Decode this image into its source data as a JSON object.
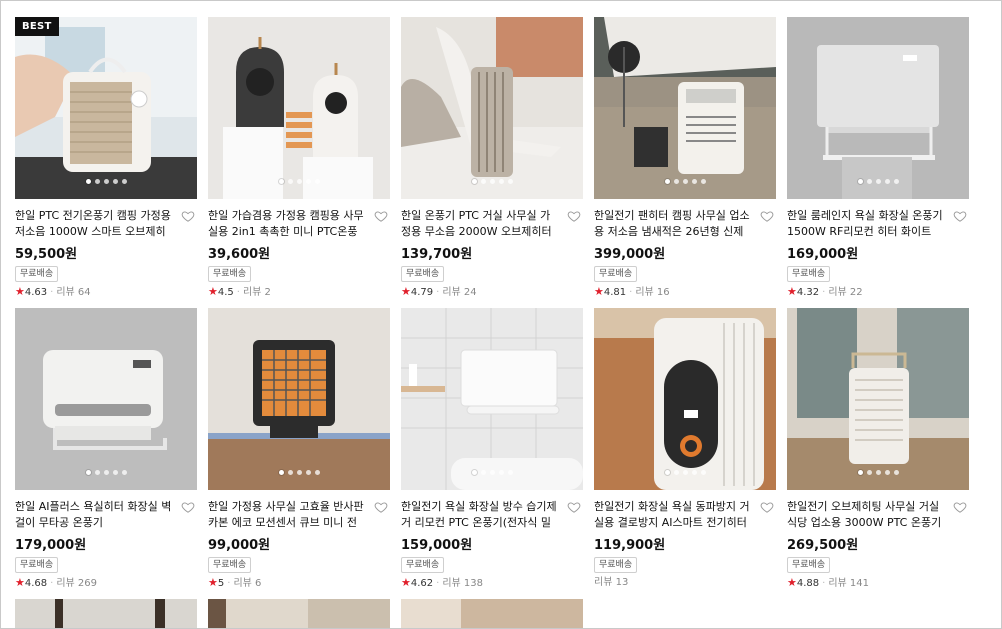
{
  "products": [
    {
      "badge": "BEST",
      "title": "한일 PTC 전기온풍기 캠핑 가정용 저소음 1000W 스마트 오브제히터",
      "price": "59,500원",
      "shipping": "무료배송",
      "rating": "4.63",
      "reviews": "리뷰 64",
      "dots": 5,
      "icon": "heart-outline-icon"
    },
    {
      "badge": "",
      "title": "한일 가습겸용 가정용 캠핑용 사무실용 2in1 촉촉한 미니 PTC온풍기",
      "price": "39,600원",
      "shipping": "무료배송",
      "rating": "4.5",
      "reviews": "리뷰 2",
      "dots": 5,
      "icon": "heart-outline-icon"
    },
    {
      "badge": "",
      "title": "한일 온풍기 PTC 거실 사무실 가정용 무소음 2000W 오브제히터",
      "price": "139,700원",
      "shipping": "무료배송",
      "rating": "4.79",
      "reviews": "리뷰 24",
      "dots": 5,
      "icon": "heart-outline-icon"
    },
    {
      "badge": "",
      "title": "한일전기 팬히터 캠핑 사무실 업소용 저소음 냄새적은 26년형 신제품...",
      "price": "399,000원",
      "shipping": "무료배송",
      "rating": "4.81",
      "reviews": "리뷰 16",
      "dots": 5,
      "icon": "heart-outline-icon"
    },
    {
      "badge": "",
      "title": "한일 룸레인지 욕실 화장실 온풍기 1500W RF리모컨 히터 화이트",
      "price": "169,000원",
      "shipping": "무료배송",
      "rating": "4.32",
      "reviews": "리뷰 22",
      "dots": 5,
      "icon": "heart-outline-icon"
    },
    {
      "badge": "",
      "title": "한일 AI플러스 욕실히터 화장실 벽걸이 무타공 온풍기",
      "price": "179,000원",
      "shipping": "무료배송",
      "rating": "4.68",
      "reviews": "리뷰 269",
      "dots": 5,
      "icon": "heart-outline-icon"
    },
    {
      "badge": "",
      "title": "한일 가정용 사무실 고효율 반사판 카본 에코 모션센서 큐브 미니 전기히터",
      "price": "99,000원",
      "shipping": "무료배송",
      "rating": "5",
      "reviews": "리뷰 6",
      "dots": 5,
      "icon": "heart-outline-icon"
    },
    {
      "badge": "",
      "title": "한일전기 욕실 화장실 방수 습기제거 리모컨 PTC 온풍기(전자식 밀크화이트)",
      "price": "159,000원",
      "shipping": "무료배송",
      "rating": "4.62",
      "reviews": "리뷰 138",
      "dots": 5,
      "icon": "heart-outline-icon"
    },
    {
      "badge": "",
      "title": "한일전기 화장실 욕실 동파방지 거실용 결로방지 AI스마트 전기히터",
      "price": "119,900원",
      "shipping": "무료배송",
      "rating": "",
      "reviews": "리뷰 13",
      "dots": 5,
      "icon": "heart-outline-icon"
    },
    {
      "badge": "",
      "title": "한일전기 오브제히팅 사무실 거실 식당 업소용 3000W PTC 온풍기",
      "price": "269,500원",
      "shipping": "무료배송",
      "rating": "4.88",
      "reviews": "리뷰 141",
      "dots": 5,
      "icon": "heart-outline-icon"
    }
  ],
  "colors": {
    "star": "#e0202c",
    "badge_bg": "#111111",
    "text": "#111111",
    "muted": "#888888"
  }
}
